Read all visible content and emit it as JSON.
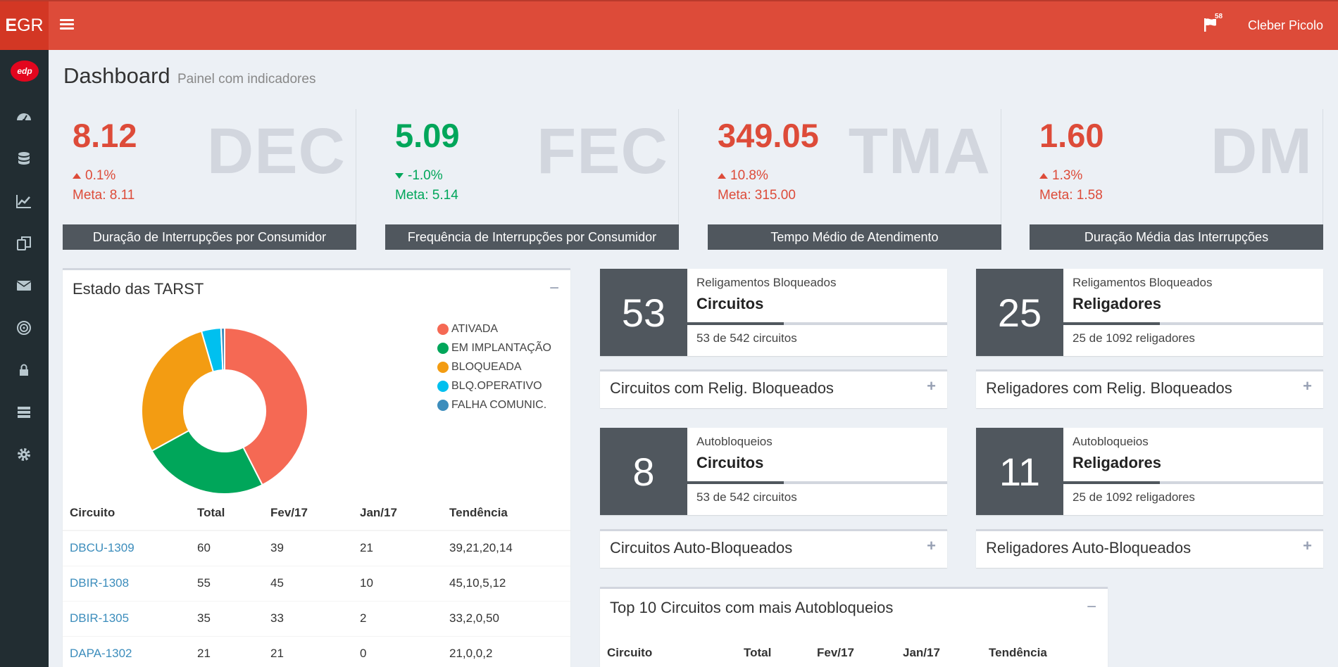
{
  "header": {
    "logo_bold": "E",
    "logo_rest": "GR",
    "notifications_count": "58",
    "user_name": "Cleber Picolo"
  },
  "sidebar": {
    "brand": "edp",
    "items": [
      {
        "icon": "dashboard-icon"
      },
      {
        "icon": "database-icon"
      },
      {
        "icon": "line-chart-icon"
      },
      {
        "icon": "copy-icon"
      },
      {
        "icon": "envelope-icon"
      },
      {
        "icon": "target-icon"
      },
      {
        "icon": "lock-icon"
      },
      {
        "icon": "server-icon"
      },
      {
        "icon": "gear-icon"
      }
    ]
  },
  "page": {
    "title": "Dashboard",
    "subtitle": "Painel com indicadores"
  },
  "kpis": [
    {
      "value": "8.12",
      "code": "DEC",
      "delta": "0.1%",
      "trend": "up",
      "meta": "Meta: 8.11",
      "footer": "Duração de Interrupções por Consumidor",
      "color": "#dd4b39"
    },
    {
      "value": "5.09",
      "code": "FEC",
      "delta": "-1.0%",
      "trend": "down",
      "meta": "Meta: 5.14",
      "footer": "Frequência de Interrupções por Consumidor",
      "color": "#00a65a"
    },
    {
      "value": "349.05",
      "code": "TMA",
      "delta": "10.8%",
      "trend": "up",
      "meta": "Meta: 315.00",
      "footer": "Tempo Médio de Atendimento",
      "color": "#dd4b39"
    },
    {
      "value": "1.60",
      "code": "DM",
      "delta": "1.3%",
      "trend": "up",
      "meta": "Meta: 1.58",
      "footer": "Duração Média das Interrupções",
      "color": "#dd4b39"
    }
  ],
  "tarst": {
    "title": "Estado das TARST",
    "collapse": "−",
    "chart_data": {
      "type": "pie",
      "categories": [
        "ATIVADA",
        "EM IMPLANTAÇÃO",
        "BLOQUEADA",
        "BLQ.OPERATIVO",
        "FALHA COMUNIC."
      ],
      "values": [
        42.5,
        24.5,
        28.5,
        3.8,
        0.7
      ],
      "colors": [
        "#f56954",
        "#00a65a",
        "#f39c12",
        "#00c0ef",
        "#3c8dbc"
      ],
      "legend": "right"
    },
    "table": {
      "headers": [
        "Circuito",
        "Total",
        "Fev/17",
        "Jan/17",
        "Tendência"
      ],
      "rows": [
        [
          "DBCU-1309",
          "60",
          "39",
          "21",
          "39,21,20,14"
        ],
        [
          "DBIR-1308",
          "55",
          "45",
          "10",
          "45,10,5,12"
        ],
        [
          "DBIR-1305",
          "35",
          "33",
          "2",
          "33,2,0,50"
        ],
        [
          "DAPA-1302",
          "21",
          "21",
          "0",
          "21,0,0,2"
        ]
      ]
    }
  },
  "infoboxes": [
    {
      "number": "53",
      "label": "Religamentos Bloqueados",
      "title": "Circuitos",
      "desc": "53 de 542 circuitos",
      "progress": 0.37
    },
    {
      "number": "25",
      "label": "Religamentos Bloqueados",
      "title": "Religadores",
      "desc": "25 de 1092 religadores",
      "progress": 0.37
    },
    {
      "number": "8",
      "label": "Autobloqueios",
      "title": "Circuitos",
      "desc": "53 de 542 circuitos",
      "progress": 0.37
    },
    {
      "number": "11",
      "label": "Autobloqueios",
      "title": "Religadores",
      "desc": "25 de 1092 religadores",
      "progress": 0.37
    }
  ],
  "collapsed_boxes": [
    {
      "title": "Circuitos com Relig. Bloqueados",
      "tool": "+"
    },
    {
      "title": "Religadores com Relig. Bloqueados",
      "tool": "+"
    },
    {
      "title": "Circuitos Auto-Bloqueados",
      "tool": "+"
    },
    {
      "title": "Religadores Auto-Bloqueados",
      "tool": "+"
    }
  ],
  "top10": {
    "title": "Top 10 Circuitos com mais Autobloqueios",
    "collapse": "−",
    "headers": [
      "Circuito",
      "Total",
      "Fev/17",
      "Jan/17",
      "Tendência"
    ]
  }
}
